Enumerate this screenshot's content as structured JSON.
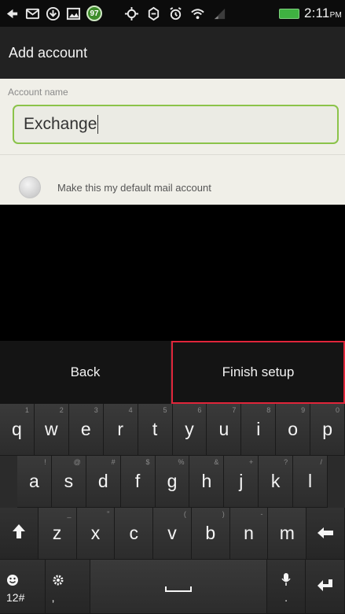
{
  "status_bar": {
    "battery_badge": "97",
    "time": "2:11",
    "ampm": "PM"
  },
  "title": "Add account",
  "form": {
    "account_name_label": "Account name",
    "account_name_value": "Exchange",
    "default_mail_label": "Make this my default mail account"
  },
  "actions": {
    "back_label": "Back",
    "finish_label": "Finish setup"
  },
  "keyboard": {
    "row1": [
      {
        "key": "q",
        "hint": "1"
      },
      {
        "key": "w",
        "hint": "2"
      },
      {
        "key": "e",
        "hint": "3"
      },
      {
        "key": "r",
        "hint": "4"
      },
      {
        "key": "t",
        "hint": "5"
      },
      {
        "key": "y",
        "hint": "6"
      },
      {
        "key": "u",
        "hint": "7"
      },
      {
        "key": "i",
        "hint": "8"
      },
      {
        "key": "o",
        "hint": "9"
      },
      {
        "key": "p",
        "hint": "0"
      }
    ],
    "row2": [
      {
        "key": "a",
        "hint": "!"
      },
      {
        "key": "s",
        "hint": "@"
      },
      {
        "key": "d",
        "hint": "#"
      },
      {
        "key": "f",
        "hint": "$"
      },
      {
        "key": "g",
        "hint": "%"
      },
      {
        "key": "h",
        "hint": "&"
      },
      {
        "key": "j",
        "hint": "+"
      },
      {
        "key": "k",
        "hint": "?"
      },
      {
        "key": "l",
        "hint": "/"
      }
    ],
    "row3": [
      {
        "key": "z",
        "hint": "_"
      },
      {
        "key": "x",
        "hint": "\""
      },
      {
        "key": "c",
        "hint": ""
      },
      {
        "key": "v",
        "hint": "("
      },
      {
        "key": "b",
        "hint": ")"
      },
      {
        "key": "n",
        "hint": "-"
      },
      {
        "key": "m",
        "hint": ""
      }
    ],
    "symbols_label": "12#",
    "comma_label": ",",
    "period_label": "."
  }
}
